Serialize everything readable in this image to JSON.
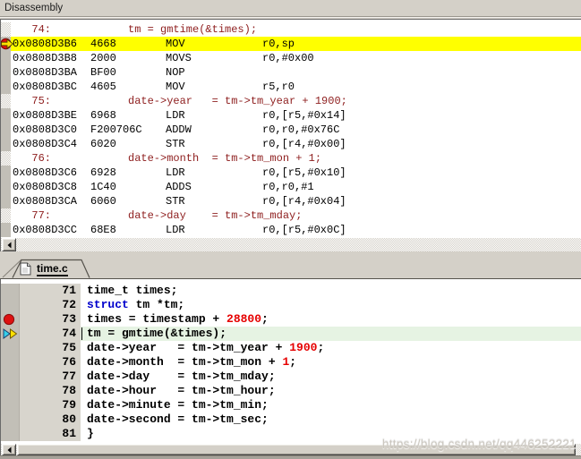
{
  "window": {
    "title": "Disassembly"
  },
  "palette": {
    "chrome": "#d4d0c8",
    "gutter": "#c2bfb7",
    "number_strip": "#d8d5cd",
    "highlight_line": "#ffff00",
    "current_line": "#e6f3e3",
    "keyword": "#0000cc",
    "number_literal": "#e60000",
    "disasm_source": "#8f2020",
    "breakpoint_red": "#dd1111",
    "arrow_cyan": "#35d0ea",
    "arrow_yellow": "#ffe000",
    "watermark_text_color": "#ccc8c0"
  },
  "disassembly": {
    "rows": [
      {
        "type": "src",
        "no": "74:",
        "text": "tm = gmtime(&times);"
      },
      {
        "type": "asm",
        "addr": "0x0808D3B6",
        "bytes": "4668",
        "mn": "MOV",
        "op": "r0,sp",
        "current": true
      },
      {
        "type": "asm",
        "addr": "0x0808D3B8",
        "bytes": "2000",
        "mn": "MOVS",
        "op": "r0,#0x00"
      },
      {
        "type": "asm",
        "addr": "0x0808D3BA",
        "bytes": "BF00",
        "mn": "NOP",
        "op": ""
      },
      {
        "type": "asm",
        "addr": "0x0808D3BC",
        "bytes": "4605",
        "mn": "MOV",
        "op": "r5,r0"
      },
      {
        "type": "src",
        "no": "75:",
        "text": "date->year   = tm->tm_year + 1900;"
      },
      {
        "type": "asm",
        "addr": "0x0808D3BE",
        "bytes": "6968",
        "mn": "LDR",
        "op": "r0,[r5,#0x14]"
      },
      {
        "type": "asm",
        "addr": "0x0808D3C0",
        "bytes": "F200706C",
        "mn": "ADDW",
        "op": "r0,r0,#0x76C"
      },
      {
        "type": "asm",
        "addr": "0x0808D3C4",
        "bytes": "6020",
        "mn": "STR",
        "op": "r0,[r4,#0x00]"
      },
      {
        "type": "src",
        "no": "76:",
        "text": "date->month  = tm->tm_mon + 1;"
      },
      {
        "type": "asm",
        "addr": "0x0808D3C6",
        "bytes": "6928",
        "mn": "LDR",
        "op": "r0,[r5,#0x10]"
      },
      {
        "type": "asm",
        "addr": "0x0808D3C8",
        "bytes": "1C40",
        "mn": "ADDS",
        "op": "r0,r0,#1"
      },
      {
        "type": "asm",
        "addr": "0x0808D3CA",
        "bytes": "6060",
        "mn": "STR",
        "op": "r0,[r4,#0x04]"
      },
      {
        "type": "src",
        "no": "77:",
        "text": "date->day    = tm->tm_mday;"
      },
      {
        "type": "asm",
        "addr": "0x0808D3CC",
        "bytes": "68E8",
        "mn": "LDR",
        "op": "r0,[r5,#0x0C]"
      }
    ]
  },
  "tabs": {
    "active_label": "time.c"
  },
  "editor": {
    "lines": [
      {
        "no": "71",
        "segs": [
          {
            "t": "time_t times;"
          }
        ]
      },
      {
        "no": "72",
        "segs": [
          {
            "t": "struct",
            "c": "kw"
          },
          {
            "t": " tm *tm;"
          }
        ]
      },
      {
        "no": "73",
        "segs": [
          {
            "t": "times = timestamp + "
          },
          {
            "t": "28800",
            "c": "num"
          },
          {
            "t": ";"
          }
        ],
        "breakpoint": true
      },
      {
        "no": "74",
        "segs": [
          {
            "t": "tm = gmtime(&times);"
          }
        ],
        "current": true
      },
      {
        "no": "75",
        "segs": [
          {
            "t": "date->year   = tm->tm_year + "
          },
          {
            "t": "1900",
            "c": "num"
          },
          {
            "t": ";"
          }
        ]
      },
      {
        "no": "76",
        "segs": [
          {
            "t": "date->month  = tm->tm_mon + "
          },
          {
            "t": "1",
            "c": "num"
          },
          {
            "t": ";"
          }
        ]
      },
      {
        "no": "77",
        "segs": [
          {
            "t": "date->day    = tm->tm_mday;"
          }
        ]
      },
      {
        "no": "78",
        "segs": [
          {
            "t": "date->hour   = tm->tm_hour;"
          }
        ]
      },
      {
        "no": "79",
        "segs": [
          {
            "t": "date->minute = tm->tm_min;"
          }
        ]
      },
      {
        "no": "80",
        "segs": [
          {
            "t": "date->second = tm->tm_sec;"
          }
        ]
      },
      {
        "no": "81",
        "segs": [
          {
            "t": "}"
          }
        ]
      }
    ]
  },
  "watermark": {
    "text": "https://blog.csdn.net/qq446252221"
  }
}
